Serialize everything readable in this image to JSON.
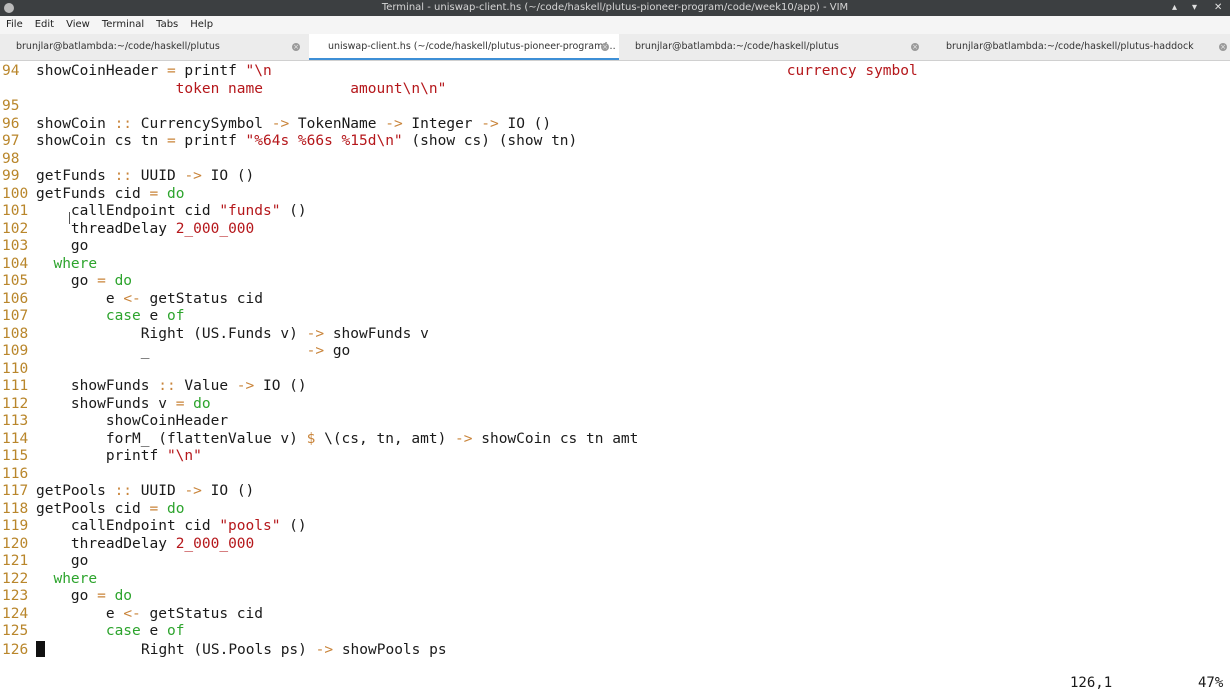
{
  "window": {
    "title": "Terminal - uniswap-client.hs (~/code/haskell/plutus-pioneer-program/code/week10/app) - VIM",
    "controls": [
      "▴",
      "▾",
      "✕"
    ]
  },
  "menu": [
    "File",
    "Edit",
    "View",
    "Terminal",
    "Tabs",
    "Help"
  ],
  "tabs": [
    {
      "label": "brunjlar@batlambda:~/code/haskell/plutus",
      "active": false
    },
    {
      "label": "uniswap-client.hs (~/code/haskell/plutus-pioneer-program/...",
      "active": true
    },
    {
      "label": "brunjlar@batlambda:~/code/haskell/plutus",
      "active": false
    },
    {
      "label": "brunjlar@batlambda:~/code/haskell/plutus-haddock",
      "active": false
    }
  ],
  "code": [
    {
      "n": "94",
      "segs": [
        [
          "",
          "showCoinHeader "
        ],
        [
          "op",
          "="
        ],
        [
          "",
          " printf "
        ],
        [
          "str",
          "\"\\n                                                           currency symbol"
        ]
      ]
    },
    {
      "n": "",
      "segs": [
        [
          "str",
          "                token name          amount\\n\\n\""
        ]
      ]
    },
    {
      "n": "95",
      "segs": []
    },
    {
      "n": "96",
      "segs": [
        [
          "",
          "showCoin "
        ],
        [
          "op",
          "::"
        ],
        [
          "",
          " CurrencySymbol "
        ],
        [
          "op",
          "->"
        ],
        [
          "",
          " TokenName "
        ],
        [
          "op",
          "->"
        ],
        [
          "",
          " Integer "
        ],
        [
          "op",
          "->"
        ],
        [
          "",
          " IO ()"
        ]
      ]
    },
    {
      "n": "97",
      "segs": [
        [
          "",
          "showCoin cs tn "
        ],
        [
          "op",
          "="
        ],
        [
          "",
          " printf "
        ],
        [
          "str",
          "\"%64s %66s %15d\\n\""
        ],
        [
          "",
          " (show cs) (show tn)"
        ]
      ]
    },
    {
      "n": "98",
      "segs": []
    },
    {
      "n": "99",
      "segs": [
        [
          "",
          "getFunds "
        ],
        [
          "op",
          "::"
        ],
        [
          "",
          " UUID "
        ],
        [
          "op",
          "->"
        ],
        [
          "",
          " IO ()"
        ]
      ]
    },
    {
      "n": "100",
      "segs": [
        [
          "",
          "getFunds cid "
        ],
        [
          "op",
          "="
        ],
        [
          "",
          " "
        ],
        [
          "kw",
          "do"
        ]
      ]
    },
    {
      "n": "101",
      "segs": [
        [
          "",
          "    callEndpoint cid "
        ],
        [
          "str",
          "\"funds\""
        ],
        [
          "",
          " ()"
        ]
      ]
    },
    {
      "n": "102",
      "segs": [
        [
          "",
          "    threadDelay "
        ],
        [
          "num",
          "2_000_000"
        ]
      ]
    },
    {
      "n": "103",
      "segs": [
        [
          "",
          "    go"
        ]
      ]
    },
    {
      "n": "104",
      "segs": [
        [
          "",
          "  "
        ],
        [
          "kw",
          "where"
        ]
      ]
    },
    {
      "n": "105",
      "segs": [
        [
          "",
          "    go "
        ],
        [
          "op",
          "="
        ],
        [
          "",
          " "
        ],
        [
          "kw",
          "do"
        ]
      ]
    },
    {
      "n": "106",
      "segs": [
        [
          "",
          "        e "
        ],
        [
          "op",
          "<-"
        ],
        [
          "",
          " getStatus cid"
        ]
      ]
    },
    {
      "n": "107",
      "segs": [
        [
          "",
          "        "
        ],
        [
          "kw",
          "case"
        ],
        [
          "",
          " e "
        ],
        [
          "kw",
          "of"
        ]
      ]
    },
    {
      "n": "108",
      "segs": [
        [
          "",
          "            Right (US.Funds v) "
        ],
        [
          "op",
          "->"
        ],
        [
          "",
          " showFunds v"
        ]
      ]
    },
    {
      "n": "109",
      "segs": [
        [
          "",
          "            _                  "
        ],
        [
          "op",
          "->"
        ],
        [
          "",
          " go"
        ]
      ]
    },
    {
      "n": "110",
      "segs": []
    },
    {
      "n": "111",
      "segs": [
        [
          "",
          "    showFunds "
        ],
        [
          "op",
          "::"
        ],
        [
          "",
          " Value "
        ],
        [
          "op",
          "->"
        ],
        [
          "",
          " IO ()"
        ]
      ]
    },
    {
      "n": "112",
      "segs": [
        [
          "",
          "    showFunds v "
        ],
        [
          "op",
          "="
        ],
        [
          "",
          " "
        ],
        [
          "kw",
          "do"
        ]
      ]
    },
    {
      "n": "113",
      "segs": [
        [
          "",
          "        showCoinHeader"
        ]
      ]
    },
    {
      "n": "114",
      "segs": [
        [
          "",
          "        forM_ (flattenValue v) "
        ],
        [
          "op",
          "$"
        ],
        [
          "",
          " \\(cs, tn, amt) "
        ],
        [
          "op",
          "->"
        ],
        [
          "",
          " showCoin cs tn amt"
        ]
      ]
    },
    {
      "n": "115",
      "segs": [
        [
          "",
          "        printf "
        ],
        [
          "str",
          "\"\\n\""
        ]
      ]
    },
    {
      "n": "116",
      "segs": []
    },
    {
      "n": "117",
      "segs": [
        [
          "",
          "getPools "
        ],
        [
          "op",
          "::"
        ],
        [
          "",
          " UUID "
        ],
        [
          "op",
          "->"
        ],
        [
          "",
          " IO ()"
        ]
      ]
    },
    {
      "n": "118",
      "segs": [
        [
          "",
          "getPools cid "
        ],
        [
          "op",
          "="
        ],
        [
          "",
          " "
        ],
        [
          "kw",
          "do"
        ]
      ]
    },
    {
      "n": "119",
      "segs": [
        [
          "",
          "    callEndpoint cid "
        ],
        [
          "str",
          "\"pools\""
        ],
        [
          "",
          " ()"
        ]
      ]
    },
    {
      "n": "120",
      "segs": [
        [
          "",
          "    threadDelay "
        ],
        [
          "num",
          "2_000_000"
        ]
      ]
    },
    {
      "n": "121",
      "segs": [
        [
          "",
          "    go"
        ]
      ]
    },
    {
      "n": "122",
      "segs": [
        [
          "",
          "  "
        ],
        [
          "kw",
          "where"
        ]
      ]
    },
    {
      "n": "123",
      "segs": [
        [
          "",
          "    go "
        ],
        [
          "op",
          "="
        ],
        [
          "",
          " "
        ],
        [
          "kw",
          "do"
        ]
      ]
    },
    {
      "n": "124",
      "segs": [
        [
          "",
          "        e "
        ],
        [
          "op",
          "<-"
        ],
        [
          "",
          " getStatus cid"
        ]
      ]
    },
    {
      "n": "125",
      "segs": [
        [
          "",
          "        "
        ],
        [
          "kw",
          "case"
        ],
        [
          "",
          " e "
        ],
        [
          "kw",
          "of"
        ]
      ]
    },
    {
      "n": "126",
      "cursor": true,
      "segs": [
        [
          "",
          "           Right (US.Pools ps) "
        ],
        [
          "op",
          "->"
        ],
        [
          "",
          " showPools ps"
        ]
      ]
    }
  ],
  "status": {
    "position": "126,1",
    "percent": "47%"
  }
}
